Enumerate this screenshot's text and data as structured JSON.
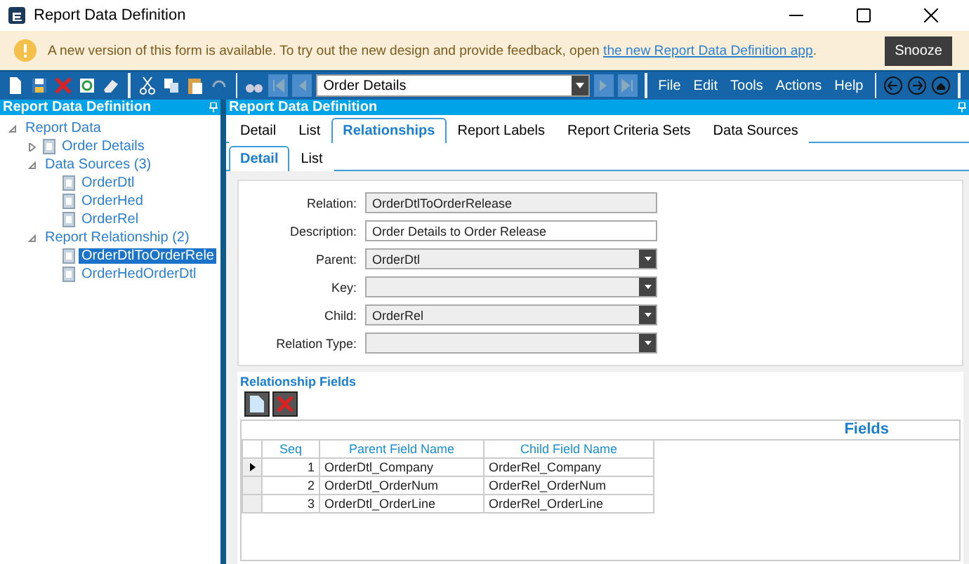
{
  "window": {
    "title": "Report Data Definition"
  },
  "banner": {
    "message": "A new version of this form is available. To try out the new design and provide feedback, open ",
    "link": "the new Report Data Definition app",
    "after": ".",
    "button": "Snooze"
  },
  "toolbar": {
    "record": "Order Details",
    "menus": [
      "File",
      "Edit",
      "Tools",
      "Actions",
      "Help"
    ]
  },
  "left_panel": {
    "title": "Report Data Definition",
    "tree": [
      {
        "label": "Report Data",
        "expanded": true,
        "selected": false,
        "children": [
          {
            "label": "Order Details",
            "expanded": false,
            "selected": false,
            "kind": "item"
          },
          {
            "label": "Data Sources (3)",
            "expanded": true,
            "selected": false,
            "kind": "group",
            "children": [
              {
                "label": "OrderDtl",
                "selected": false,
                "kind": "item"
              },
              {
                "label": "OrderHed",
                "selected": false,
                "kind": "item"
              },
              {
                "label": "OrderRel",
                "selected": false,
                "kind": "item"
              }
            ]
          },
          {
            "label": "Report Relationship (2)",
            "expanded": true,
            "selected": false,
            "kind": "group",
            "children": [
              {
                "label": "OrderDtlToOrderRele",
                "selected": true,
                "kind": "item"
              },
              {
                "label": "OrderHedOrderDtl",
                "selected": false,
                "kind": "item"
              }
            ]
          }
        ]
      }
    ]
  },
  "right_panel": {
    "title": "Report Data Definition",
    "tabs": [
      {
        "label": "Detail",
        "selected": false
      },
      {
        "label": "List",
        "selected": false
      },
      {
        "label": "Relationships",
        "selected": true
      },
      {
        "label": "Report Labels",
        "selected": false
      },
      {
        "label": "Report Criteria Sets",
        "selected": false
      },
      {
        "label": "Data Sources",
        "selected": false
      }
    ],
    "subtabs": [
      {
        "label": "Detail",
        "selected": true
      },
      {
        "label": "List",
        "selected": false
      }
    ],
    "fields": [
      {
        "label": "Relation:",
        "value": "OrderDtlToOrderRelease",
        "kind": "text",
        "readonly": true
      },
      {
        "label": "Description:",
        "value": "Order Details to Order Release",
        "kind": "text",
        "readonly": false
      },
      {
        "label": "Parent:",
        "value": "OrderDtl",
        "kind": "combo",
        "readonly": true
      },
      {
        "label": "Key:",
        "kind": "combo",
        "readonly": true
      },
      {
        "label": "Child:",
        "value": "OrderRel",
        "kind": "combo",
        "readonly": true
      },
      {
        "label": "Relation Type:",
        "kind": "combo",
        "readonly": true
      }
    ],
    "relationship_fields": {
      "title": "Relationship Fields",
      "caption": "Fields",
      "columns": [
        "Seq",
        "Parent Field Name",
        "Child Field Name"
      ],
      "rows": [
        {
          "cells": [
            "1",
            "OrderDtl_Company",
            "OrderRel_Company"
          ],
          "current": true
        },
        {
          "cells": [
            "2",
            "OrderDtl_OrderNum",
            "OrderRel_OrderNum"
          ],
          "current": false
        },
        {
          "cells": [
            "3",
            "OrderDtl_OrderLine",
            "OrderRel_OrderLine"
          ],
          "current": false
        }
      ]
    }
  }
}
